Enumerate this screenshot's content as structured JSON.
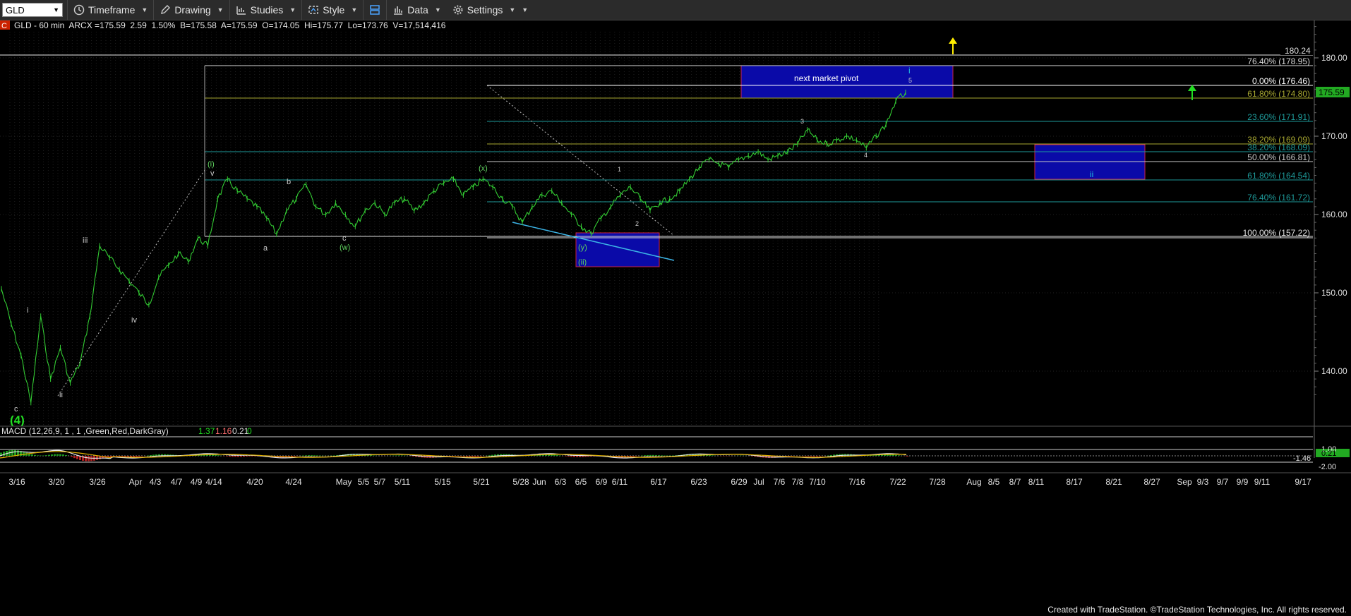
{
  "toolbar": {
    "symbol": "GLD",
    "items": [
      {
        "label": "Timeframe",
        "icon": "clock-icon"
      },
      {
        "label": "Drawing",
        "icon": "pencil-icon"
      },
      {
        "label": "Studies",
        "icon": "studies-icon"
      },
      {
        "label": "Style",
        "icon": "style-icon"
      },
      {
        "label": "",
        "icon": "layout-icon"
      },
      {
        "label": "Data",
        "icon": "bar-chart-icon"
      },
      {
        "label": "Settings",
        "icon": "gear-icon"
      }
    ]
  },
  "header": {
    "badge": "C",
    "text": "GLD - 60 min  ARCX =175.59  2.59  1.50%  B=175.58  A=175.59  O=174.05  Hi=175.77  Lo=173.76  V=17,514,416"
  },
  "chart_data": {
    "type": "line",
    "symbol": "GLD",
    "timeframe": "60 min",
    "last_price": 175.59,
    "price_axis": {
      "ticks": [
        140.0,
        150.0,
        160.0,
        170.0,
        180.0
      ],
      "ylim": [
        133.5,
        186
      ],
      "top_label": 180.24
    },
    "date_axis": [
      "3/16",
      "3/20",
      "3/26",
      "Apr",
      "4/3",
      "4/7",
      "4/9",
      "4/14",
      "4/20",
      "4/24",
      "May",
      "5/5",
      "5/7",
      "5/11",
      "5/15",
      "5/21",
      "5/28",
      "Jun",
      "6/3",
      "6/5",
      "6/9",
      "6/11",
      "6/17",
      "6/23",
      "6/29",
      "Jul",
      "7/6",
      "7/8",
      "7/10",
      "7/16",
      "7/22",
      "7/28",
      "Aug",
      "8/5",
      "8/7",
      "8/11",
      "8/17",
      "8/21",
      "8/27",
      "Sep",
      "9/3",
      "9/7",
      "9/9",
      "9/11",
      "9/17"
    ],
    "price_series": [
      {
        "date": "3/13",
        "price": 150.5
      },
      {
        "date": "3/14",
        "price": 146.0
      },
      {
        "date": "3/15",
        "price": 142.0
      },
      {
        "date": "3/16",
        "price": 136.0
      },
      {
        "date": "3/17",
        "price": 147.0
      },
      {
        "date": "3/18",
        "price": 139.0
      },
      {
        "date": "3/19",
        "price": 143.0
      },
      {
        "date": "3/20",
        "price": 138.5
      },
      {
        "date": "3/23",
        "price": 141.0
      },
      {
        "date": "3/24",
        "price": 147.0
      },
      {
        "date": "3/25",
        "price": 156.0
      },
      {
        "date": "3/26",
        "price": 154.5
      },
      {
        "date": "3/27",
        "price": 153.0
      },
      {
        "date": "3/30",
        "price": 151.5
      },
      {
        "date": "3/31",
        "price": 150.0
      },
      {
        "date": "4/1",
        "price": 148.5
      },
      {
        "date": "4/2",
        "price": 152.0
      },
      {
        "date": "4/3",
        "price": 153.5
      },
      {
        "date": "4/6",
        "price": 155.0
      },
      {
        "date": "4/7",
        "price": 154.0
      },
      {
        "date": "4/8",
        "price": 157.0
      },
      {
        "date": "4/9",
        "price": 156.0
      },
      {
        "date": "4/13",
        "price": 162.0
      },
      {
        "date": "4/14",
        "price": 164.5
      },
      {
        "date": "4/15",
        "price": 163.0
      },
      {
        "date": "4/16",
        "price": 162.0
      },
      {
        "date": "4/17",
        "price": 161.0
      },
      {
        "date": "4/20",
        "price": 159.5
      },
      {
        "date": "4/21",
        "price": 157.5
      },
      {
        "date": "4/22",
        "price": 160.5
      },
      {
        "date": "4/23",
        "price": 162.0
      },
      {
        "date": "4/24",
        "price": 163.8
      },
      {
        "date": "4/27",
        "price": 161.0
      },
      {
        "date": "4/28",
        "price": 160.0
      },
      {
        "date": "4/29",
        "price": 161.5
      },
      {
        "date": "4/30",
        "price": 160.0
      },
      {
        "date": "5/1",
        "price": 158.5
      },
      {
        "date": "5/4",
        "price": 160.5
      },
      {
        "date": "5/5",
        "price": 161.5
      },
      {
        "date": "5/6",
        "price": 160.0
      },
      {
        "date": "5/7",
        "price": 161.5
      },
      {
        "date": "5/8",
        "price": 162.0
      },
      {
        "date": "5/11",
        "price": 160.5
      },
      {
        "date": "5/12",
        "price": 161.5
      },
      {
        "date": "5/13",
        "price": 163.0
      },
      {
        "date": "5/14",
        "price": 164.0
      },
      {
        "date": "5/15",
        "price": 164.5
      },
      {
        "date": "5/18",
        "price": 162.5
      },
      {
        "date": "5/19",
        "price": 163.5
      },
      {
        "date": "5/20",
        "price": 164.5
      },
      {
        "date": "5/21",
        "price": 163.5
      },
      {
        "date": "5/22",
        "price": 162.0
      },
      {
        "date": "5/26",
        "price": 161.0
      },
      {
        "date": "5/27",
        "price": 159.0
      },
      {
        "date": "5/28",
        "price": 161.0
      },
      {
        "date": "5/29",
        "price": 162.5
      },
      {
        "date": "6/1",
        "price": 163.0
      },
      {
        "date": "6/2",
        "price": 161.5
      },
      {
        "date": "6/3",
        "price": 160.0
      },
      {
        "date": "6/4",
        "price": 158.5
      },
      {
        "date": "6/5",
        "price": 157.5
      },
      {
        "date": "6/8",
        "price": 159.5
      },
      {
        "date": "6/9",
        "price": 161.0
      },
      {
        "date": "6/10",
        "price": 162.5
      },
      {
        "date": "6/11",
        "price": 163.5
      },
      {
        "date": "6/12",
        "price": 162.0
      },
      {
        "date": "6/15",
        "price": 160.5
      },
      {
        "date": "6/16",
        "price": 161.5
      },
      {
        "date": "6/17",
        "price": 162.0
      },
      {
        "date": "6/18",
        "price": 163.0
      },
      {
        "date": "6/19",
        "price": 164.5
      },
      {
        "date": "6/22",
        "price": 166.0
      },
      {
        "date": "6/23",
        "price": 167.0
      },
      {
        "date": "6/24",
        "price": 166.5
      },
      {
        "date": "6/25",
        "price": 166.0
      },
      {
        "date": "6/26",
        "price": 167.0
      },
      {
        "date": "6/29",
        "price": 167.5
      },
      {
        "date": "6/30",
        "price": 168.0
      },
      {
        "date": "7/1",
        "price": 167.0
      },
      {
        "date": "7/2",
        "price": 167.5
      },
      {
        "date": "7/6",
        "price": 168.0
      },
      {
        "date": "7/7",
        "price": 169.0
      },
      {
        "date": "7/8",
        "price": 170.8
      },
      {
        "date": "7/9",
        "price": 169.5
      },
      {
        "date": "7/10",
        "price": 169.0
      },
      {
        "date": "7/13",
        "price": 169.5
      },
      {
        "date": "7/14",
        "price": 170.0
      },
      {
        "date": "7/15",
        "price": 169.5
      },
      {
        "date": "7/16",
        "price": 168.5
      },
      {
        "date": "7/17",
        "price": 170.0
      },
      {
        "date": "7/20",
        "price": 171.5
      },
      {
        "date": "7/21",
        "price": 174.5
      },
      {
        "date": "7/22",
        "price": 175.59
      }
    ],
    "fib_levels": [
      {
        "label": "76.40% (178.95)",
        "price": 178.95,
        "color": "#d8d8d8"
      },
      {
        "label": "0.00% (176.46)",
        "price": 176.46,
        "color": "#ffffff"
      },
      {
        "label": "61.80% (174.80)",
        "price": 174.8,
        "color": "#a8a830"
      },
      {
        "label": "23.60% (171.91)",
        "price": 171.91,
        "color": "#1e9a9a"
      },
      {
        "label": "38.20% (169.09)",
        "price": 169.09,
        "color": "#a8a830"
      },
      {
        "label": "38.20% (168.09)",
        "price": 168.09,
        "color": "#1e9a9a"
      },
      {
        "label": "50.00% (166.81)",
        "price": 166.81,
        "color": "#c8c8c8"
      },
      {
        "label": "61.80% (164.54)",
        "price": 164.54,
        "color": "#1e9a9a"
      },
      {
        "label": "76.40% (161.72)",
        "price": 161.72,
        "color": "#1e9a9a"
      },
      {
        "label": "100.00% (157.22)",
        "price": 157.22,
        "color": "#e0e0e0"
      }
    ],
    "annotations": [
      {
        "text": "next market pivot",
        "color": "#ffffff"
      },
      {
        "text": "(4)",
        "color": "#22dd22"
      },
      {
        "text": "c",
        "color": "#cccccc"
      },
      {
        "text": "i",
        "color": "#cccccc"
      },
      {
        "text": "ii",
        "color": "#cccccc"
      },
      {
        "text": "iii",
        "color": "#cccccc"
      },
      {
        "text": "iv",
        "color": "#cccccc"
      },
      {
        "text": "v",
        "color": "#cccccc"
      },
      {
        "text": "(i)",
        "color": "#5fd35f"
      },
      {
        "text": "a",
        "color": "#cccccc"
      },
      {
        "text": "b",
        "color": "#cccccc"
      },
      {
        "text": "c",
        "color": "#cccccc"
      },
      {
        "text": "(w)",
        "color": "#5fd35f"
      },
      {
        "text": "(x)",
        "color": "#5fd35f"
      },
      {
        "text": "(y)",
        "color": "#5fd35f"
      },
      {
        "text": "(ii)",
        "color": "#5fd35f"
      },
      {
        "text": "1",
        "color": "#cccccc"
      },
      {
        "text": "2",
        "color": "#cccccc"
      },
      {
        "text": "3",
        "color": "#cccccc"
      },
      {
        "text": "4",
        "color": "#cccccc"
      },
      {
        "text": "5",
        "color": "#cccccc"
      },
      {
        "text": "i",
        "color": "#20c0e0"
      },
      {
        "text": "ii",
        "color": "#20c0e0"
      }
    ],
    "macd": {
      "label": "MACD (12,26,9, 1 , 1 ,Green,Red,DarkGray)",
      "values": [
        1.37,
        1.16,
        0.21,
        0.0
      ],
      "axis_labels": [
        "1.00",
        "0.21",
        "-1.46",
        "-2.00"
      ]
    },
    "grid": true
  },
  "colors": {
    "background": "#000000",
    "price": "#33cc33",
    "box": "#0a0aa8",
    "box_border": "#cc2244",
    "up_arrow_yellow": "#ffee00",
    "up_arrow_green": "#22dd22"
  },
  "footer": "Created with TradeStation. ©TradeStation Technologies, Inc. All rights reserved."
}
